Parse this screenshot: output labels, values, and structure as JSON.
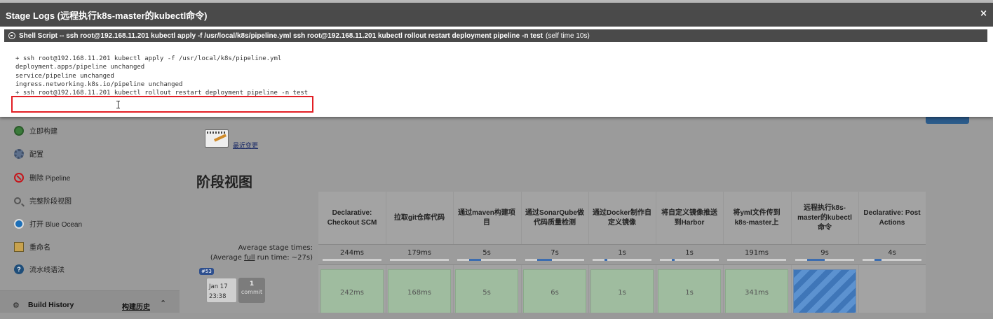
{
  "modal": {
    "title": "Stage Logs (远程执行k8s-master的kubectl命令)",
    "close": "×",
    "step_title": "Shell Script -- ssh root@192.168.11.201 kubectl apply -f /usr/local/k8s/pipeline.yml ssh root@192.168.11.201 kubectl rollout restart deployment pipeline -n test",
    "step_time": "(self time 10s)",
    "console_lines": [
      "+ ssh root@192.168.11.201 kubectl apply -f /usr/local/k8s/pipeline.yml",
      "deployment.apps/pipeline unchanged",
      "service/pipeline unchanged",
      "ingress.networking.k8s.io/pipeline unchanged",
      "+ ssh root@192.168.11.201 kubectl rollout restart deployment pipeline -n test"
    ]
  },
  "sidebar": {
    "items": [
      {
        "label": "立即构建",
        "icon": "build-now-icon"
      },
      {
        "label": "配置",
        "icon": "gear-icon"
      },
      {
        "label": "删除 Pipeline",
        "icon": "delete-icon"
      },
      {
        "label": "完整阶段视图",
        "icon": "search-icon"
      },
      {
        "label": "打开 Blue Ocean",
        "icon": "blue-ocean-icon"
      },
      {
        "label": "重命名",
        "icon": "rename-icon"
      },
      {
        "label": "流水线语法",
        "icon": "help-icon"
      }
    ],
    "build_history": {
      "title": "Build History",
      "link": "构建历史",
      "chevron": "^"
    }
  },
  "main": {
    "recent_changes": "最近变更",
    "stage_view_title": "阶段视图",
    "avg_label_line1": "Average stage times:",
    "avg_label_line2": "(Average full run time: ~27s)",
    "stages": [
      {
        "name": "Declarative: Checkout SCM",
        "avg": "244ms",
        "run": "242ms",
        "fill": 0
      },
      {
        "name": "拉取git仓库代码",
        "avg": "179ms",
        "run": "168ms",
        "fill": 0
      },
      {
        "name": "通过maven构建项目",
        "avg": "5s",
        "run": "5s",
        "fill": 0.2
      },
      {
        "name": "通过SonarQube做代码质量检测",
        "avg": "7s",
        "run": "6s",
        "fill": 0.25
      },
      {
        "name": "通过Docker制作自定义镜像",
        "avg": "1s",
        "run": "1s",
        "fill": 0.05
      },
      {
        "name": "将自定义镜像推送到Harbor",
        "avg": "1s",
        "run": "1s",
        "fill": 0.05
      },
      {
        "name": "将yml文件传到k8s-master上",
        "avg": "191ms",
        "run": "341ms",
        "fill": 0
      },
      {
        "name": "远程执行k8s-master的kubectl命令",
        "avg": "9s",
        "run": "",
        "fill": 0.3
      },
      {
        "name": "Declarative: Post Actions",
        "avg": "4s",
        "run": "",
        "fill": 0.12
      }
    ],
    "run": {
      "badge": "#53",
      "date": "Jan 17",
      "time": "23:38",
      "commits": "1",
      "commit_label": "commit"
    }
  }
}
